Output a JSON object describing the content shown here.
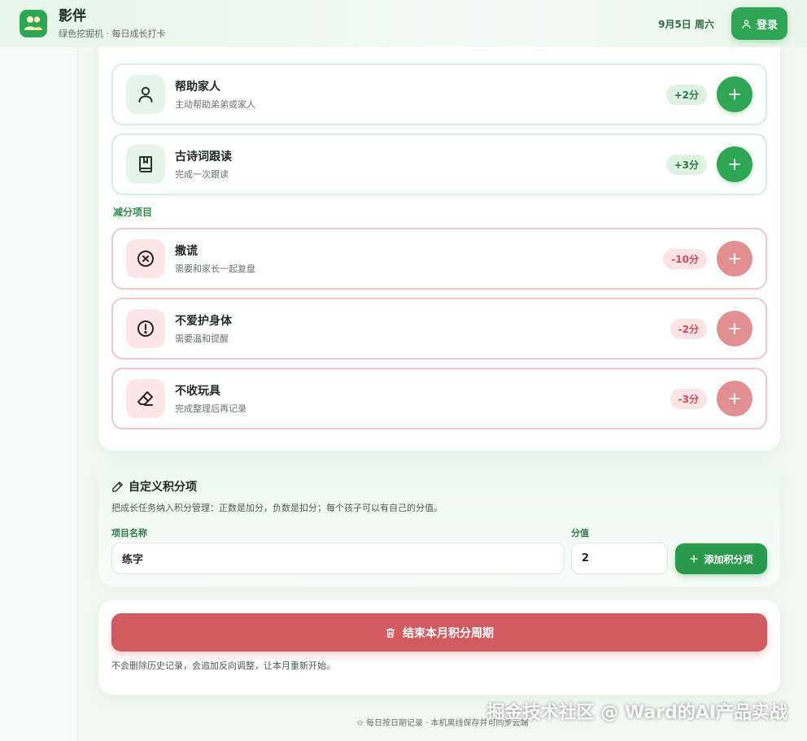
{
  "header": {
    "app_name": "影伴",
    "subtitle": "绿色挖掘机 · 每日成长打卡",
    "date": "9月5日 周六",
    "login_label": "登录"
  },
  "positive_items": [
    {
      "name": "帮助家人",
      "desc": "主动帮助弟弟或家人",
      "points": "+2分",
      "icon": "person-icon"
    },
    {
      "name": "古诗词跟读",
      "desc": "完成一次跟读",
      "points": "+3分",
      "icon": "book-icon"
    }
  ],
  "negative_section_label": "减分项目",
  "negative_items": [
    {
      "name": "撒谎",
      "desc": "需要和家长一起复盘",
      "points": "-10分",
      "icon": "x-circle-icon"
    },
    {
      "name": "不爱护身体",
      "desc": "需要温和提醒",
      "points": "-2分",
      "icon": "alert-circle-icon"
    },
    {
      "name": "不收玩具",
      "desc": "完成整理后再记录",
      "points": "-3分",
      "icon": "eraser-icon"
    }
  ],
  "custom": {
    "title": "自定义积分项",
    "description": "把成长任务纳入积分管理：正数是加分，负数是扣分；每个孩子可以有自己的分值。",
    "name_label": "项目名称",
    "name_value": "练字",
    "value_label": "分值",
    "value_value": "2",
    "add_label": "添加积分项"
  },
  "end_cycle": {
    "button_label": "结束本月积分周期",
    "note": "不会删除历史记录，会追加反向调整，让本月重新开始。"
  },
  "footer": {
    "text": "✩ 每日按日期记录 · 本机离线保存并可同步云端"
  },
  "watermark": "掘金技术社区 @ Ward的AI产品实战",
  "colors": {
    "primary": "#2ea653",
    "danger": "#d05c62",
    "danger_light": "#e28f92"
  }
}
